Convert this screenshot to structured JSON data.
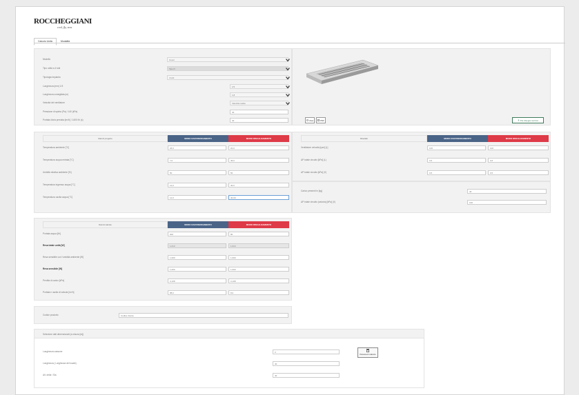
{
  "brand": {
    "name": "ROCCHEGGIANI",
    "tagline": "cool, fly, now"
  },
  "tabs": [
    {
      "label": "Calcolo Unità"
    },
    {
      "label": "Modalità"
    }
  ],
  "config": {
    "rows": [
      {
        "label": "Modello",
        "value": "Cover"
      },
      {
        "label": "Tipo unità a 4 tubi",
        "value": "Tipo D"
      },
      {
        "label": "Tipologia impianto",
        "value": "4 tubi"
      },
      {
        "label": "Lunghezza (mm) 1/3",
        "value": "1/3"
      },
      {
        "label": "Lunghezza consigliata (m)",
        "value": "1,8"
      },
      {
        "label": "Velocità del ventilatore",
        "value": "Velocità media"
      },
      {
        "label": "Pressione di spinta (Pa) / 140 (kPa)",
        "value": "40"
      },
      {
        "label": "Portata d'aria prevista [m³/h] / 1400 l/h (s)",
        "value": "40"
      }
    ],
    "image_buttons": {
      "view": "View",
      "pdf": "PDF",
      "download": "Per disegno tecnico"
    }
  },
  "input_table": {
    "headers": {
      "label": "Dati di progetto",
      "summer": "MODO RAFFREDDAMENTO",
      "winter": "MODO RISCALDAMENTO"
    },
    "rows": [
      {
        "label": "Temperatura ambiente [°C]",
        "summer": "26,0",
        "winter": "20,0"
      },
      {
        "label": "Temperatura acqua entrata [°C]",
        "summer": "7,0",
        "winter": "45,0"
      },
      {
        "label": "Umidità relativa ambiente [%]",
        "summer": "50",
        "winter": "50"
      },
      {
        "label": "Temperatura ingresso acqua [°C]",
        "summer": "12,0",
        "winter": "40,0"
      },
      {
        "label": "Temperatura uscita acqua [°C]",
        "summer": "12,0",
        "winter": "40,00"
      }
    ]
  },
  "result_table": {
    "headers": {
      "label": "Risultati",
      "summer": "MODO RAFFREDDAMENTO",
      "winter": "MODO RISCALDAMENTO"
    },
    "rows": [
      {
        "label": "Ventilatore velocità [rpm] [L]",
        "summer": "100",
        "winter": "100"
      },
      {
        "label": "ΔP totale circuito [kPa] (L)",
        "summer": "0,5",
        "winter": "0,5"
      },
      {
        "label": "ΔP totale circuito [kPa] (V)",
        "summer": "0,5",
        "winter": "0,5"
      }
    ],
    "extra": [
      {
        "label": "Carico presenti in [kg]",
        "value": "40"
      },
      {
        "label": "ΔP totale circuito (valvola) [kPa] (V)",
        "value": "100"
      }
    ]
  },
  "output_table": {
    "headers": {
      "label": "Dati di calcolo",
      "summer": "MODO RAFFREDDAMENTO",
      "winter": "MODO RISCALDAMENTO"
    },
    "rows": [
      {
        "label": "Portata acqua [l/h]",
        "summer": "600",
        "winter": "80",
        "bold": false
      },
      {
        "label": "Resa totale unità [W]",
        "summer": "1.013",
        "winter": "1.013",
        "bold": true
      },
      {
        "label": "Resa sensibile con l'umidità ambiente [W]",
        "summer": "1.000",
        "winter": "1.000",
        "bold": false
      },
      {
        "label": "Resa sensibile [W]",
        "summer": "1.000",
        "winter": "1.000",
        "bold": true
      },
      {
        "label": "Perdita di carico [kPa]",
        "summer": "0,108",
        "winter": "0,108",
        "bold": false
      },
      {
        "label": "Portata e uscita di valvola [m³/h]",
        "summer": "88,0",
        "winter": "8,0",
        "bold": false
      }
    ]
  },
  "notes": {
    "label": "Codice prodotto",
    "value": "Codice cliente"
  },
  "bottom": {
    "title": "Selezione dati dimensionali (a misura [m])",
    "rows": [
      {
        "label": "Lunghezza cassone",
        "value": "0"
      },
      {
        "label": "Lunghezza ( Larghezza del locale)",
        "value": "40"
      },
      {
        "label": "Alt. della / Sia",
        "value": "40"
      }
    ],
    "calc_button": "Parametri calcolo"
  },
  "colors": {
    "blue": "#4a6487",
    "red": "#de3a47",
    "green": "#3d7a5a"
  },
  "icons": {
    "chevron": "chevron-down-icon",
    "calculator": "calculator-icon"
  }
}
